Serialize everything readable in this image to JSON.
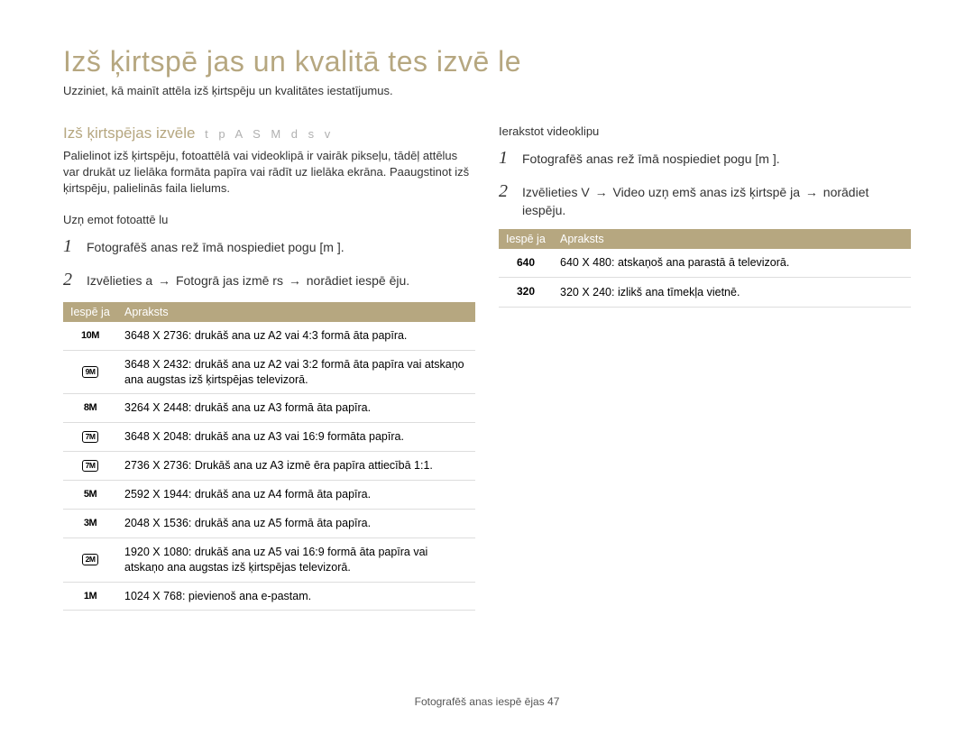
{
  "page": {
    "title": "Izš ķirtspē jas un kvalitā tes izvē le",
    "subtitle": "Uzziniet, kā mainīt attēla izš ķirtspēju un kvalitātes iestatījumus."
  },
  "section1": {
    "heading": "Izš ķirtspējas izvēle",
    "modes": "t p A S M d s v",
    "body": "Palielinot izš ķirtspēju, fotoattēlā vai videoklipā ir vairāk pikseļu, tādēļ attēlus var drukāt uz lielāka formāta papīra vai rādīt uz lielāka ekrāna. Paaugstinot izš ķirtspēju, palielinās faila lielums."
  },
  "photo": {
    "context": "Uzņ emot fotoattē lu",
    "step1_prefix": "Fotografēš anas rež īmā nospiediet pogu [m",
    "step1_suffix": "].",
    "step2_a": "Izvēlieties a",
    "step2_b": "Fotogrā  jas izmē  rs",
    "step2_c": "norādiet iespē  ēju.",
    "table_head_opt": "Iespē ja",
    "table_head_desc": "Apraksts",
    "rows": [
      {
        "icon_text": "10M",
        "icon_class": "icon-bold",
        "desc": "3648 X 2736: drukāš ana uz A2 vai 4:3 formā āta papīra."
      },
      {
        "icon_text": "9M",
        "icon_class": "icon-box",
        "desc": "3648 X 2432: drukāš ana uz A2 vai 3:2 formā āta papīra vai atskaņo ana augstas izš  ķirtspējas televizorā."
      },
      {
        "icon_text": "8M",
        "icon_class": "icon-bold",
        "desc": "3264 X 2448: drukāš ana uz A3 formā āta papīra."
      },
      {
        "icon_text": "7M",
        "icon_class": "icon-box",
        "desc": "3648 X 2048: drukāš ana uz  A3 vai 16:9 formāta papīra."
      },
      {
        "icon_text": "7M",
        "icon_class": "icon-box",
        "desc": "2736 X 2736: Drukāš ana uz A3 izmē ēra papīra attiecībā 1:1."
      },
      {
        "icon_text": "5M",
        "icon_class": "icon-bold",
        "desc": "2592 X 1944: drukāš ana uz A4 formā āta papīra."
      },
      {
        "icon_text": "3M",
        "icon_class": "icon-bold",
        "desc": "2048 X 1536: drukāš ana uz A5 formā āta papīra."
      },
      {
        "icon_text": "2M",
        "icon_class": "icon-box",
        "desc": "1920 X 1080: drukāš ana uz A5 vai 16:9 formā āta papīra vai atskaņo ana augstas izš  ķirtspējas televizorā."
      },
      {
        "icon_text": "1M",
        "icon_class": "icon-bold",
        "desc": "1024 X 768: pievienoš ana e-pastam."
      }
    ]
  },
  "video": {
    "context": "Ierakstot videoklipu",
    "step1_prefix": "Fotografēš anas rež īmā nospiediet pogu [m",
    "step1_suffix": "].",
    "step2_a": "Izvēlieties V",
    "step2_b": "Video uzņ emš anas izš ķirtspē ja",
    "step2_c": "norādiet iespēju.",
    "table_head_opt": "Iespē ja",
    "table_head_desc": "Apraksts",
    "rows": [
      {
        "icon_text": "640",
        "icon_class": "icon-vid",
        "desc": "640 X 480: atskaņoš ana parastā ā televizorā."
      },
      {
        "icon_text": "320",
        "icon_class": "icon-vid",
        "desc": "320 X 240: izlikš ana tīmekļa vietnē."
      }
    ]
  },
  "footer": {
    "text": "Fotografēš anas iespē ējas  47"
  }
}
